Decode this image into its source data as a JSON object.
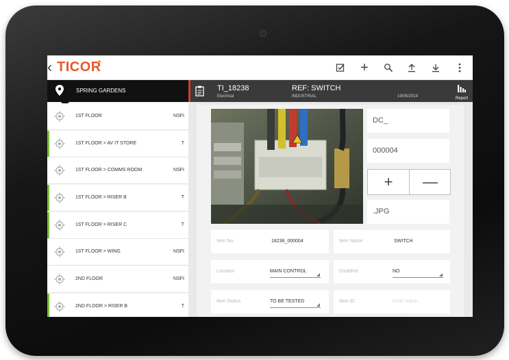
{
  "app": {
    "name": "TICOR"
  },
  "sidebar": {
    "location": "SPRING GARDENS",
    "items": [
      {
        "label": "1ST FLOOR",
        "code": "NSFI",
        "accent": false
      },
      {
        "label": "1ST FLOOR > AV IT STORE",
        "code": "T",
        "accent": true
      },
      {
        "label": "1ST FLOOR > COMMS ROOM",
        "code": "NSFI",
        "accent": false
      },
      {
        "label": "1ST FLOOR > RISER B",
        "code": "T",
        "accent": true
      },
      {
        "label": "1ST FLOOR > RISER C",
        "code": "T",
        "accent": true
      },
      {
        "label": "1ST FLOOR > WING",
        "code": "NSFI",
        "accent": false
      },
      {
        "label": "2ND FLOOR",
        "code": "NSFI",
        "accent": false
      },
      {
        "label": "2ND FLOOR > RISER B",
        "code": "T",
        "accent": true
      }
    ]
  },
  "detail": {
    "id": "TI_18238",
    "category": "Electrical",
    "ref": "REF: SWITCH",
    "type": "INDUSTRIAL",
    "date": "19/05/2014",
    "report_label": "Report",
    "prefix": "DC_",
    "number": "000004",
    "extension": ".JPG",
    "item_no_label": "Item No.",
    "item_no": "18238_000004",
    "item_name_label": "Item Name",
    "item_name": "SWITCH",
    "location_label": "Location",
    "location": "MAIN CONTROL",
    "disabled_label": "Disabled",
    "disabled": "NO",
    "status_label": "Item Status",
    "status": "TO BE TESTED",
    "item_id_label": "Item ID",
    "item_id_placeholder": "Enter Value..."
  },
  "colors": {
    "brand": "#e8582a",
    "accent_green": "#7bbf3b",
    "divider_red": "#d13c2b",
    "header_dark": "#3a3a3a"
  },
  "icons": [
    "back-arrow-icon",
    "checklist-icon",
    "plus-icon",
    "search-icon",
    "upload-icon",
    "download-icon",
    "more-vert-icon",
    "map-pin-icon",
    "target-icon",
    "clipboard-icon",
    "bar-chart-icon"
  ]
}
